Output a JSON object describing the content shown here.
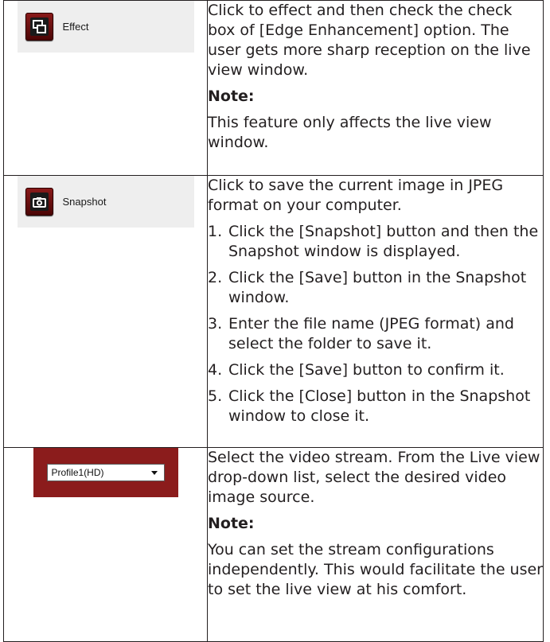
{
  "rows": [
    {
      "control": {
        "kind": "icon-button",
        "icon": "effect-icon",
        "label": "Effect"
      },
      "description": {
        "intro": "Click to effect and then check the check box of [Edge Enhancement] option. The user gets more sharp reception on the live view window.",
        "note_heading": "Note:",
        "note_text": "This feature only affects the live view window."
      }
    },
    {
      "control": {
        "kind": "icon-button",
        "icon": "camera-icon",
        "label": "Snapshot"
      },
      "description": {
        "intro": "Click to save the current image in JPEG format on your computer.",
        "steps": [
          {
            "num": "1.",
            "text": "Click the [Snapshot] button and then the Snapshot window is displayed."
          },
          {
            "num": "2.",
            "text": "Click the [Save] button in the Snapshot window."
          },
          {
            "num": "3.",
            "text": "Enter the file name (JPEG format) and select the folder to save it."
          },
          {
            "num": "4.",
            "text": "Click the [Save] button to confirm it."
          },
          {
            "num": "5.",
            "text": "Click the [Close] button in the Snapshot window to close it."
          }
        ]
      }
    },
    {
      "control": {
        "kind": "dropdown",
        "selected": "Profile1(HD)",
        "icon": "chevron-down-icon"
      },
      "description": {
        "intro": "Select the video stream. From the Live view drop-down list, select the desired video image source.",
        "note_heading": "Note:",
        "note_text": "You can set the stream configurations independently. This would facilitate the user to set the live view at his comfort."
      }
    }
  ],
  "colors": {
    "text": "#231f20",
    "button_red": "#8a1a1a",
    "panel_gray": "#eeeeee",
    "dropdown_bar": "#8b1c1c"
  }
}
